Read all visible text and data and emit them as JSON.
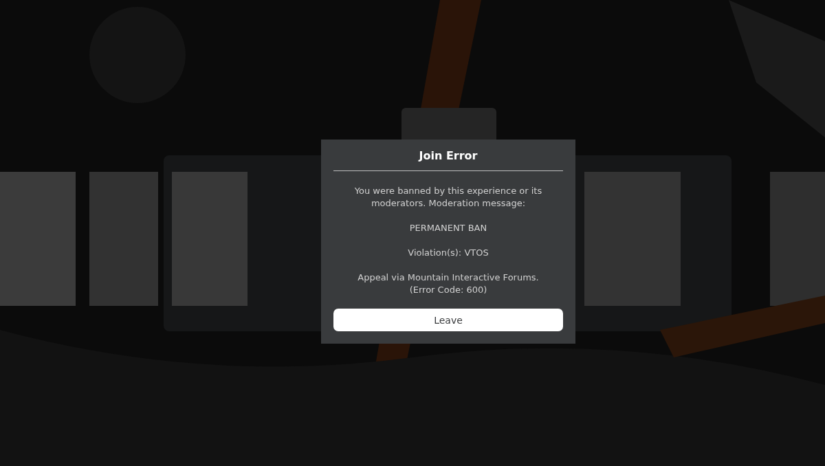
{
  "dialog": {
    "title": "Join Error",
    "paragraphs": [
      "You were banned by this experience or its moderators. Moderation message:",
      "PERMANENT BAN",
      "Violation(s): VTOS",
      "Appeal via Mountain Interactive Forums.\n(Error Code: 600)"
    ],
    "buttons": [
      "Leave"
    ]
  }
}
